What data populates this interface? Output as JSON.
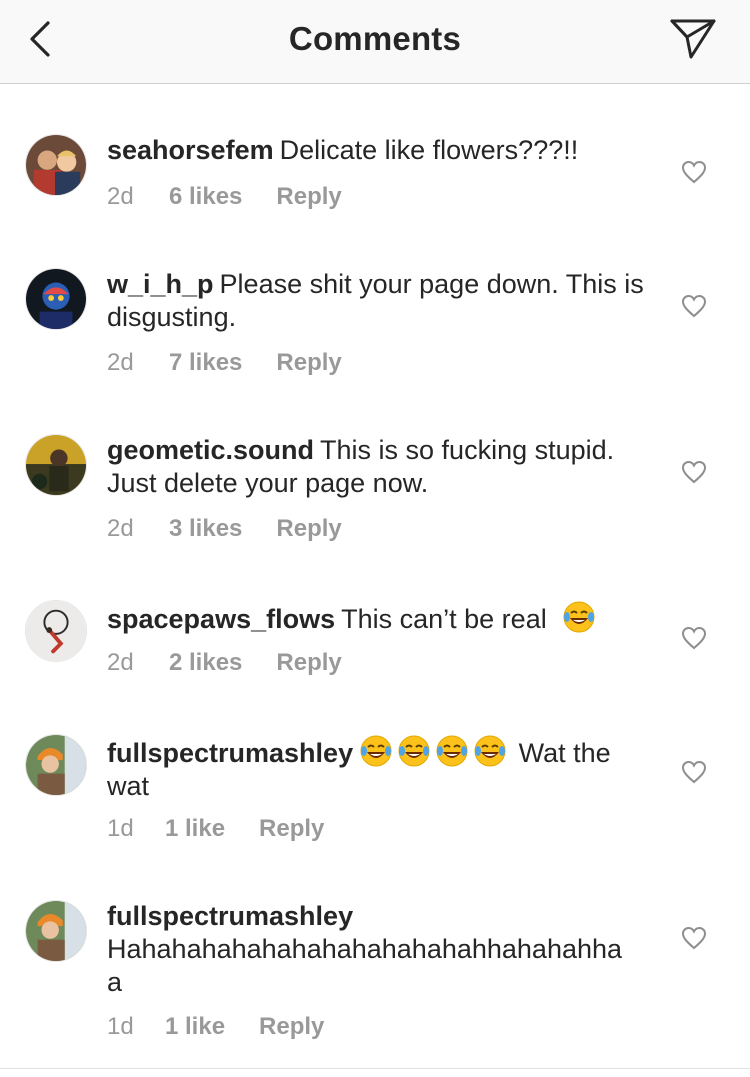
{
  "header": {
    "title": "Comments",
    "back_icon": "chevron-left-icon",
    "share_icon": "paper-plane-icon"
  },
  "colors": {
    "text": "#262626",
    "meta": "#999999",
    "header_bg": "#f9f9f9",
    "divider": "#cfcfcf"
  },
  "comments": [
    {
      "username": "seahorsefem",
      "text": "Delicate like flowers???!!",
      "time": "2d",
      "likes": "6 likes",
      "reply": "Reply"
    },
    {
      "username": "w_i_h_p",
      "text": "Please shit your page down. This is disgusting.",
      "time": "2d",
      "likes": "7 likes",
      "reply": "Reply"
    },
    {
      "username": "geometic.sound",
      "text": "This is so fucking stupid. Just delete your page now.",
      "time": "2d",
      "likes": "3 likes",
      "reply": "Reply"
    },
    {
      "username": "spacepaws_flows",
      "text": "This can’t be real",
      "emoji_icon": "face-with-tears-of-joy-icon",
      "time": "2d",
      "likes": "2 likes",
      "reply": "Reply"
    },
    {
      "username": "fullspectrumashley",
      "text": "Wat the wat",
      "emoji_icon": "face-with-tears-of-joy-icon",
      "time": "1d",
      "likes": "1 like",
      "reply": "Reply"
    },
    {
      "username": "fullspectrumashley",
      "text": "Hahahahahahahahahahahahahhahahahhaa",
      "time": "1d",
      "likes": "1 like",
      "reply": "Reply"
    }
  ]
}
